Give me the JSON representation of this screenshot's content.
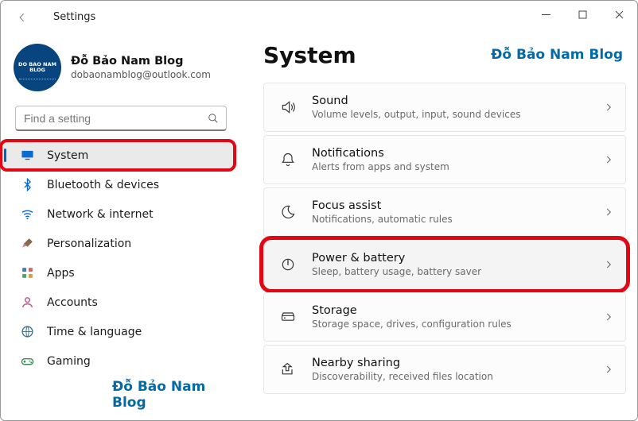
{
  "window": {
    "title": "Settings"
  },
  "user": {
    "name": "Đỗ Bảo Nam Blog",
    "email": "dobaonamblog@outlook.com",
    "avatar_text": "DO BAO NAM BLOG"
  },
  "search": {
    "placeholder": "Find a setting"
  },
  "nav": {
    "items": [
      {
        "label": "System",
        "icon": "monitor",
        "selected": true,
        "highlighted": true
      },
      {
        "label": "Bluetooth & devices",
        "icon": "bluetooth"
      },
      {
        "label": "Network & internet",
        "icon": "wifi"
      },
      {
        "label": "Personalization",
        "icon": "brush"
      },
      {
        "label": "Apps",
        "icon": "apps"
      },
      {
        "label": "Accounts",
        "icon": "user"
      },
      {
        "label": "Time & language",
        "icon": "globe"
      },
      {
        "label": "Gaming",
        "icon": "gamepad"
      }
    ]
  },
  "main": {
    "title": "System",
    "cards": [
      {
        "title": "Sound",
        "sub": "Volume levels, output, input, sound devices",
        "icon": "sound"
      },
      {
        "title": "Notifications",
        "sub": "Alerts from apps and system",
        "icon": "bell"
      },
      {
        "title": "Focus assist",
        "sub": "Notifications, automatic rules",
        "icon": "moon"
      },
      {
        "title": "Power & battery",
        "sub": "Sleep, battery usage, battery saver",
        "icon": "power",
        "highlighted": true,
        "hover": true
      },
      {
        "title": "Storage",
        "sub": "Storage space, drives, configuration rules",
        "icon": "storage"
      },
      {
        "title": "Nearby sharing",
        "sub": "Discoverability, received files location",
        "icon": "share"
      }
    ]
  },
  "watermark": "Đỗ Bảo Nam Blog"
}
